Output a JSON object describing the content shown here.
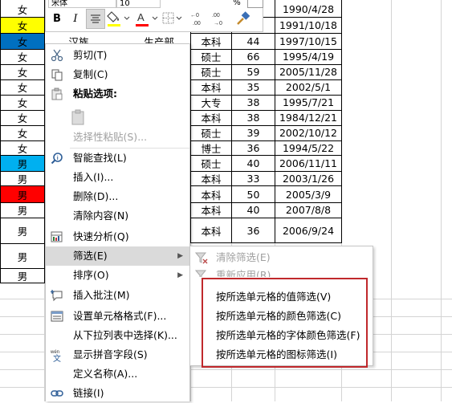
{
  "sheet": {
    "colA": [
      {
        "text": "女",
        "fill": ""
      },
      {
        "text": "女",
        "fill": "#ffff00"
      },
      {
        "text": "女",
        "fill": "#0070c0"
      },
      {
        "text": "女",
        "fill": ""
      },
      {
        "text": "女",
        "fill": ""
      },
      {
        "text": "女",
        "fill": ""
      },
      {
        "text": "女",
        "fill": ""
      },
      {
        "text": "女",
        "fill": ""
      },
      {
        "text": "女",
        "fill": ""
      },
      {
        "text": "女",
        "fill": ""
      },
      {
        "text": "男",
        "fill": "#00b0f0"
      },
      {
        "text": "男",
        "fill": ""
      },
      {
        "text": "男",
        "fill": "#ff0000"
      },
      {
        "text": "男",
        "fill": ""
      },
      {
        "text": "男",
        "fill": ""
      },
      {
        "text": "男",
        "fill": ""
      },
      {
        "text": "男",
        "fill": ""
      }
    ],
    "row3_partial": {
      "c1": "汉族",
      "c2": "生产部"
    },
    "colE": [
      "",
      "",
      "本科",
      "硕士",
      "硕士",
      "本科",
      "大专",
      "本科",
      "硕士",
      "博士",
      "硕士",
      "本科",
      "本科",
      "本科",
      "本科"
    ],
    "colF": [
      "",
      "",
      "44",
      "66",
      "59",
      "35",
      "38",
      "38",
      "39",
      "36",
      "40",
      "33",
      "50",
      "40",
      "36"
    ],
    "colG": [
      "1990/4/28",
      "1991/10/18",
      "1997/10/15",
      "1995/4/19",
      "2005/11/28",
      "2002/5/1",
      "1995/7/21",
      "1984/12/21",
      "2002/10/12",
      "1994/5/22",
      "2006/11/11",
      "2003/1/26",
      "2005/3/9",
      "2007/8/8",
      "2006/9/24"
    ]
  },
  "toolbar": {
    "font_name": "宋体",
    "font_size": "10",
    "bold": "B",
    "italic": "I",
    "pct": "%",
    "inc_decimal": "←0 .00",
    "dec_decimal": ".00 →0",
    "font_color": "A",
    "fill_color": "#ffff00",
    "font_color_bar": "#ff0000"
  },
  "menu": {
    "items": [
      {
        "label": "剪切(T)",
        "icon": "scissors-icon",
        "disabled": false
      },
      {
        "label": "复制(C)",
        "icon": "copy-icon",
        "disabled": false
      },
      {
        "label": "粘贴选项:",
        "icon": "paste-icon",
        "disabled": false
      },
      {
        "label": "",
        "icon": "paste-clipboard-icon",
        "disabled": false
      },
      {
        "label": "选择性粘贴(S)...",
        "icon": "",
        "disabled": true
      },
      {
        "label": "智能查找(L)",
        "icon": "smart-lookup-icon",
        "disabled": false
      },
      {
        "label": "插入(I)...",
        "icon": "",
        "disabled": false
      },
      {
        "label": "删除(D)...",
        "icon": "",
        "disabled": false
      },
      {
        "label": "清除内容(N)",
        "icon": "",
        "disabled": false
      },
      {
        "label": "快速分析(Q)",
        "icon": "quick-analysis-icon",
        "disabled": false
      },
      {
        "label": "筛选(E)",
        "icon": "",
        "disabled": false
      },
      {
        "label": "排序(O)",
        "icon": "",
        "disabled": false
      },
      {
        "label": "插入批注(M)",
        "icon": "comment-icon",
        "disabled": false
      },
      {
        "label": "设置单元格格式(F)...",
        "icon": "format-cells-icon",
        "disabled": false
      },
      {
        "label": "从下拉列表中选择(K)...",
        "icon": "",
        "disabled": false
      },
      {
        "label": "显示拼音字段(S)",
        "icon": "phonetic-icon",
        "disabled": false
      },
      {
        "label": "定义名称(A)...",
        "icon": "",
        "disabled": false
      },
      {
        "label": "链接(I)",
        "icon": "link-icon",
        "disabled": false
      }
    ]
  },
  "submenu": {
    "items": [
      {
        "label": "清除筛选(E)",
        "disabled": true
      },
      {
        "label": "重新应用(R)",
        "disabled": true
      },
      {
        "label": "按所选单元格的值筛选(V)",
        "disabled": false
      },
      {
        "label": "按所选单元格的颜色筛选(C)",
        "disabled": false
      },
      {
        "label": "按所选单元格的字体颜色筛选(F)",
        "disabled": false
      },
      {
        "label": "按所选单元格的图标筛选(I)",
        "disabled": false
      }
    ]
  }
}
